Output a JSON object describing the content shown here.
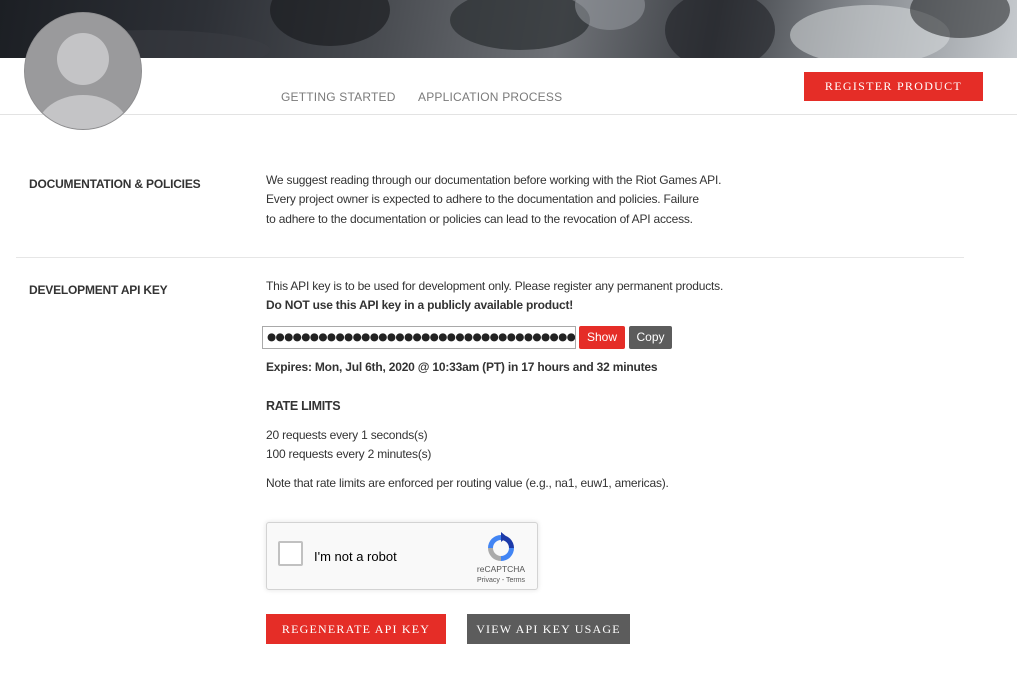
{
  "header": {
    "nav": [
      {
        "label": "GETTING STARTED"
      },
      {
        "label": "APPLICATION PROCESS"
      }
    ],
    "register_label": "REGISTER PRODUCT"
  },
  "documentation": {
    "title": "DOCUMENTATION & POLICIES",
    "lines": [
      "We suggest reading through our documentation before working with the Riot Games API.",
      "Every project owner is expected to adhere to the documentation and policies. Failure",
      "to adhere to the documentation or policies can lead to the revocation of API access."
    ]
  },
  "dev_key": {
    "title": "DEVELOPMENT API KEY",
    "note": "This API key is to be used for development only. Please register any permanent products.",
    "warning": "Do NOT use this API key in a publicly available product!",
    "masked_key": "●●●●●●●●●●●●●●●●●●●●●●●●●●●●●●●●●●●●●●●●",
    "show_label": "Show",
    "copy_label": "Copy",
    "expires": "Expires: Mon, Jul 6th, 2020 @ 10:33am (PT) in 17 hours and 32 minutes"
  },
  "rate_limits": {
    "title": "RATE LIMITS",
    "limits": [
      "20 requests every 1 seconds(s)",
      "100 requests every 2 minutes(s)"
    ],
    "note": "Note that rate limits are enforced per routing value (e.g., na1, euw1, americas)."
  },
  "captcha": {
    "label": "I'm not a robot",
    "brand": "reCAPTCHA",
    "terms": "Privacy - Terms",
    "checked": false
  },
  "actions": {
    "regenerate_label": "REGENERATE API KEY",
    "usage_label": "VIEW API KEY USAGE"
  },
  "colors": {
    "accent": "#e52d27",
    "secondary_button": "#5c5c5c",
    "text": "#333333"
  },
  "icons": {
    "avatar": "default-user-avatar-icon",
    "captcha_logo": "recaptcha-logo-icon"
  }
}
